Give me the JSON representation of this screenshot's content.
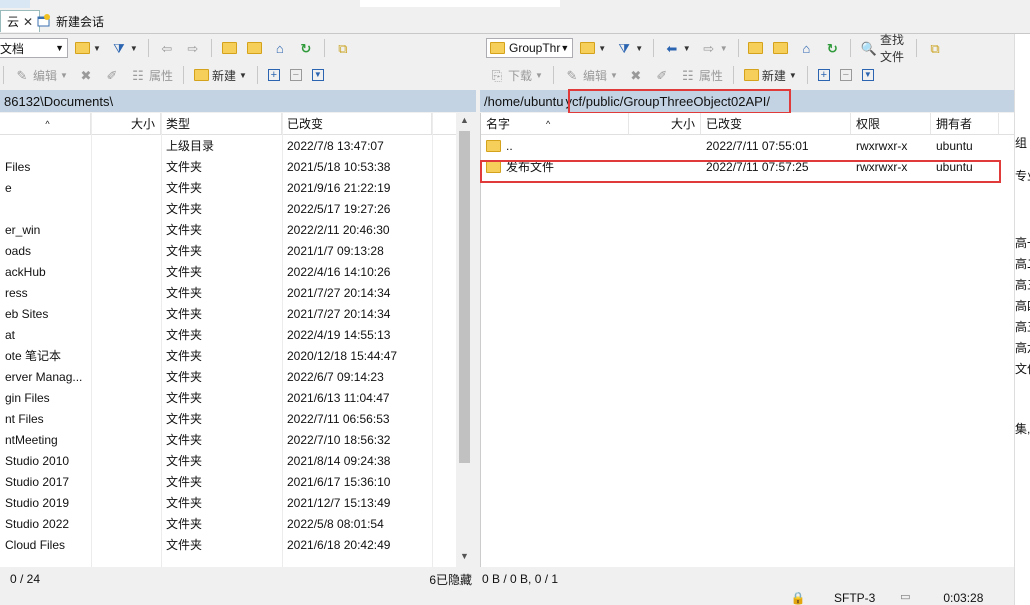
{
  "tabs": [
    {
      "label": "云"
    },
    {
      "label": "新建会话"
    }
  ],
  "left": {
    "drive_combo": "文档",
    "toolbar": {
      "edit": "编辑",
      "properties": "属性",
      "new": "新建"
    },
    "path": "86132\\Documents\\",
    "columns": {
      "size": "大小",
      "type": "类型",
      "modified": "已改变"
    },
    "rows": [
      {
        "name": "",
        "type": "上级目录",
        "modified": "2022/7/8  13:47:07"
      },
      {
        "name": "Files",
        "type": "文件夹",
        "modified": "2021/5/18  10:53:38"
      },
      {
        "name": "e",
        "type": "文件夹",
        "modified": "2021/9/16  21:22:19"
      },
      {
        "name": "",
        "type": "文件夹",
        "modified": "2022/5/17  19:27:26"
      },
      {
        "name": "er_win",
        "type": "文件夹",
        "modified": "2022/2/11  20:46:30"
      },
      {
        "name": "oads",
        "type": "文件夹",
        "modified": "2021/1/7  09:13:28"
      },
      {
        "name": "ackHub",
        "type": "文件夹",
        "modified": "2022/4/16  14:10:26"
      },
      {
        "name": "ress",
        "type": "文件夹",
        "modified": "2021/7/27  20:14:34"
      },
      {
        "name": "eb Sites",
        "type": "文件夹",
        "modified": "2021/7/27  20:14:34"
      },
      {
        "name": "at",
        "type": "文件夹",
        "modified": "2022/4/19  14:55:13"
      },
      {
        "name": "ote 笔记本",
        "type": "文件夹",
        "modified": "2020/12/18  15:44:47"
      },
      {
        "name": "erver Manag...",
        "type": "文件夹",
        "modified": "2022/6/7  09:14:23"
      },
      {
        "name": "gin Files",
        "type": "文件夹",
        "modified": "2021/6/13  11:04:47"
      },
      {
        "name": "nt Files",
        "type": "文件夹",
        "modified": "2022/7/11  06:56:53"
      },
      {
        "name": "ntMeeting",
        "type": "文件夹",
        "modified": "2022/7/10  18:56:32"
      },
      {
        "name": "Studio 2010",
        "type": "文件夹",
        "modified": "2021/8/14  09:24:38"
      },
      {
        "name": "Studio 2017",
        "type": "文件夹",
        "modified": "2021/6/17  15:36:10"
      },
      {
        "name": "Studio 2019",
        "type": "文件夹",
        "modified": "2021/12/7  15:13:49"
      },
      {
        "name": "Studio 2022",
        "type": "文件夹",
        "modified": "2022/5/8  08:01:54"
      },
      {
        "name": "Cloud Files",
        "type": "文件夹",
        "modified": "2021/6/18  20:42:49"
      }
    ],
    "status_left": "0 / 24",
    "status_right": "6已隐藏"
  },
  "right": {
    "dir_combo": "GroupThr",
    "toolbar": {
      "find": "查找文件",
      "download": "下载",
      "edit": "编辑",
      "properties": "属性",
      "new": "新建"
    },
    "path_prefix": "/home/ubuntu",
    "path_highlight": "ycf/public/GroupThreeObject02API/",
    "columns": {
      "name": "名字",
      "size": "大小",
      "modified": "已改变",
      "perm": "权限",
      "owner": "拥有者"
    },
    "rows": [
      {
        "name": "..",
        "modified": "2022/7/11  07:55:01",
        "perm": "rwxrwxr-x",
        "owner": "ubuntu"
      },
      {
        "name": "发布文件",
        "modified": "2022/7/11  07:57:25",
        "perm": "rwxrwxr-x",
        "owner": "ubuntu"
      }
    ],
    "status": "0 B / 0 B,  0 / 1"
  },
  "footer": {
    "protocol": "SFTP-3",
    "time": "0:03:28"
  },
  "edge_right": [
    "组",
    "专业",
    "高一",
    "高二",
    "高三",
    "高四",
    "高五",
    "高六",
    "文件",
    "集,"
  ]
}
